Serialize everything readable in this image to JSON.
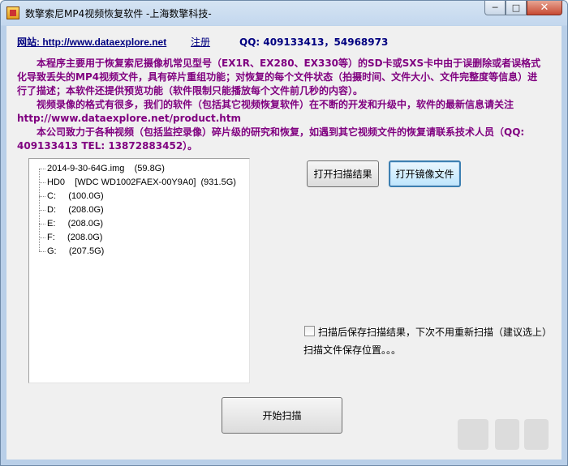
{
  "window": {
    "title": "数擎索尼MP4视频恢复软件   -上海数擎科技-"
  },
  "header": {
    "site_link": "网站: http://www.dataexplore.net",
    "register_link": "注册",
    "qq": "QQ: 409133413，54968973"
  },
  "description": {
    "paragraph1": "本程序主要用于恢复索尼摄像机常见型号（EX1R、EX280、EX330等）的SD卡或SXS卡中由于误删除或者误格式化导致丢失的MP4视频文件，具有碎片重组功能；对恢复的每个文件状态（拍摄时间、文件大小、文件完整度等信息）进行了描述；本软件还提供预览功能（软件限制只能播放每个文件前几秒的内容）。",
    "paragraph2": "视频录像的格式有很多，我们的软件（包括其它视频恢复软件）在不断的开发和升级中，软件的最新信息请关注 http://www.dataexplore.net/product.htm",
    "paragraph3": "本公司致力于各种视频（包括监控录像）碎片级的研究和恢复，如遇到其它视频文件的恢复请联系技术人员（QQ: 409133413  TEL: 13872883452）。"
  },
  "tree": {
    "items": [
      "2014-9-30-64G.img    (59.8G)",
      "HD0    [WDC WD1002FAEX-00Y9A0]  (931.5G)",
      "C:     (100.0G)",
      "D:     (208.0G)",
      "E:     (208.0G)",
      "F:     (208.0G)",
      "G:     (207.5G)"
    ]
  },
  "buttons": {
    "open_scan_result": "打开扫描结果",
    "open_image_file": "打开镜像文件",
    "start_scan": "开始扫描"
  },
  "options": {
    "save_scan_result_label": "扫描后保存扫描结果，下次不用重新扫描（建议选上）",
    "save_scan_result_checked": false,
    "save_location_label": "扫描文件保存位置。。。"
  },
  "icons": {
    "app": "app-icon",
    "minimize": "minimize-icon",
    "maximize": "maximize-icon",
    "close": "close-icon"
  },
  "colors": {
    "description_text": "#800080",
    "link": "#000080",
    "titlebar": "#c3d7ee",
    "client_bg": "#f0f0f0"
  }
}
